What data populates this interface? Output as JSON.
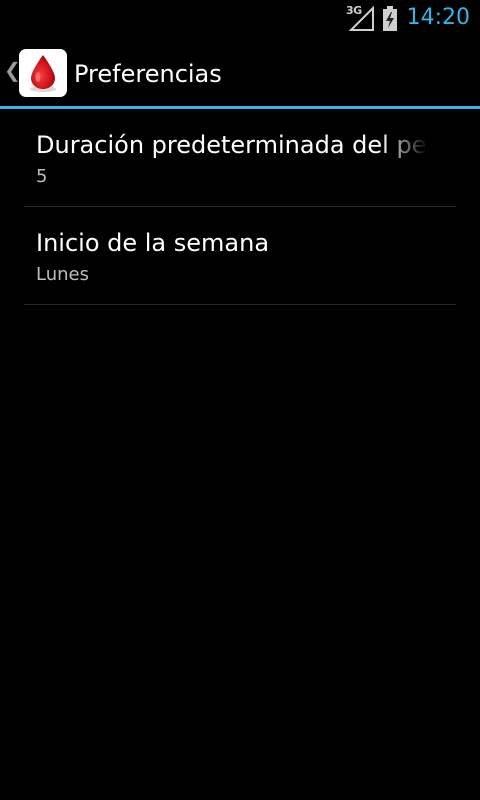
{
  "status_bar": {
    "network_type": "3G",
    "time": "14:20",
    "icons": [
      "signal-icon",
      "battery-charging-icon"
    ]
  },
  "action_bar": {
    "up_icon": "chevron-left-icon",
    "app_icon": "blood-drop-icon",
    "title": "Preferencias"
  },
  "preferences": [
    {
      "title": "Duración predeterminada del periodo",
      "summary": "5"
    },
    {
      "title": "Inicio de la semana",
      "summary": "Lunes"
    }
  ],
  "colors": {
    "accent": "#33b5e5",
    "background": "#000000",
    "drop_red": "#d0021b"
  }
}
